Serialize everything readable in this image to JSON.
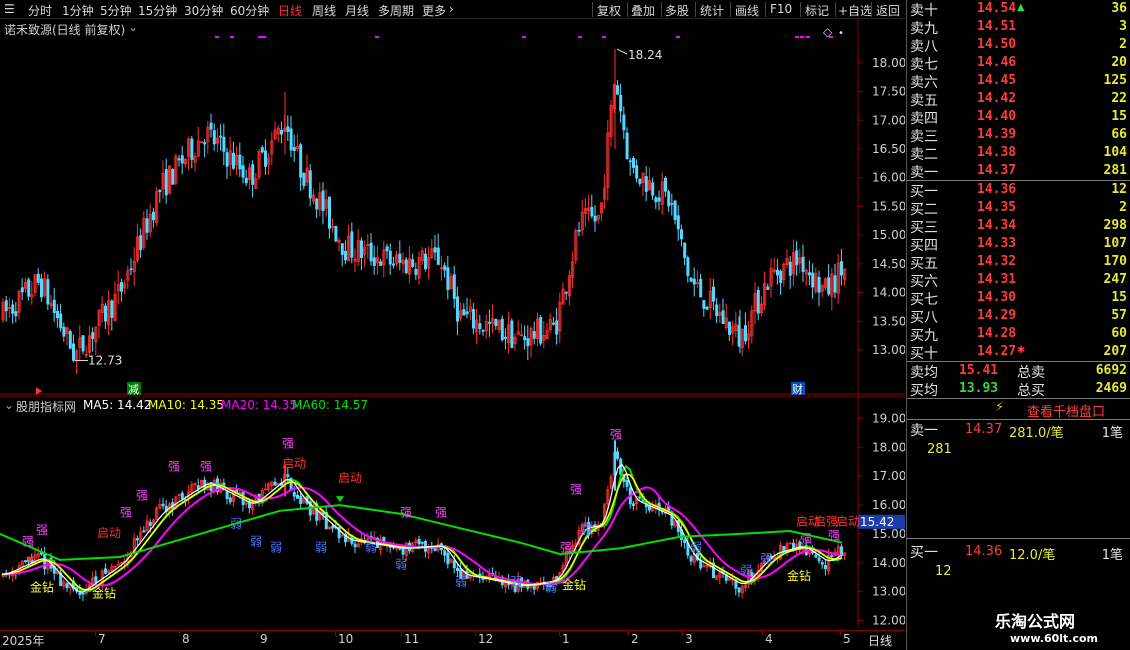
{
  "toolbar": {
    "periods": [
      "分时",
      "1分钟",
      "5分钟",
      "15分钟",
      "30分钟",
      "60分钟",
      "日线",
      "周线",
      "月线",
      "多周期",
      "更多"
    ],
    "active_period": "日线",
    "buttons": [
      "复权",
      "叠加",
      "多股",
      "统计",
      "画线",
      "F10",
      "标记",
      "+自选",
      "返回"
    ]
  },
  "main_chart": {
    "title": "诺禾致源(日线 前复权)",
    "high_label": "18.24",
    "low_label": "12.73",
    "marker_jian": "减",
    "marker_cai": "财",
    "y_ticks": [
      "18.00",
      "17.50",
      "17.00",
      "16.50",
      "16.00",
      "15.50",
      "15.00",
      "14.50",
      "14.00",
      "13.50",
      "13.00"
    ]
  },
  "indicator_chart": {
    "title": "股朋指标网",
    "ma5": "MA5: 14.42",
    "ma10": "MA10: 14.35",
    "ma20": "MA20: 14.35",
    "ma60": "MA60: 14.57",
    "current_price": "15.42",
    "y_ticks": [
      "19.00",
      "18.00",
      "17.00",
      "16.00",
      "15.00",
      "14.00",
      "13.00",
      "12.00"
    ],
    "labels": {
      "qiang": "强",
      "ruo": "弱",
      "qidong": "启动",
      "jinzuan": "金钻",
      "qiangruo": "启强"
    }
  },
  "bottom_axis": {
    "year_label": "2025年",
    "months": [
      "7",
      "8",
      "9",
      "10",
      "11",
      "12",
      "1",
      "2",
      "3",
      "4",
      "5"
    ],
    "period": "日线"
  },
  "orderbook": {
    "asks": [
      {
        "label": "卖十",
        "price": "14.54",
        "vol": "36",
        "tick": "up"
      },
      {
        "label": "卖九",
        "price": "14.51",
        "vol": "3"
      },
      {
        "label": "卖八",
        "price": "14.50",
        "vol": "2"
      },
      {
        "label": "卖七",
        "price": "14.46",
        "vol": "20"
      },
      {
        "label": "卖六",
        "price": "14.45",
        "vol": "125"
      },
      {
        "label": "卖五",
        "price": "14.42",
        "vol": "22"
      },
      {
        "label": "卖四",
        "price": "14.40",
        "vol": "15"
      },
      {
        "label": "卖三",
        "price": "14.39",
        "vol": "66"
      },
      {
        "label": "卖二",
        "price": "14.38",
        "vol": "104"
      },
      {
        "label": "卖一",
        "price": "14.37",
        "vol": "281"
      }
    ],
    "bids": [
      {
        "label": "买一",
        "price": "14.36",
        "vol": "12"
      },
      {
        "label": "买二",
        "price": "14.35",
        "vol": "2"
      },
      {
        "label": "买三",
        "price": "14.34",
        "vol": "298"
      },
      {
        "label": "买四",
        "price": "14.33",
        "vol": "107"
      },
      {
        "label": "买五",
        "price": "14.32",
        "vol": "170"
      },
      {
        "label": "买六",
        "price": "14.31",
        "vol": "247"
      },
      {
        "label": "买七",
        "price": "14.30",
        "vol": "15"
      },
      {
        "label": "买八",
        "price": "14.29",
        "vol": "57"
      },
      {
        "label": "买九",
        "price": "14.28",
        "vol": "60"
      },
      {
        "label": "买十",
        "price": "14.27",
        "vol": "207",
        "tick": "star"
      }
    ],
    "sell_avg_label": "卖均",
    "sell_avg": "15.41",
    "sell_total_label": "总卖",
    "sell_total": "6692",
    "buy_avg_label": "买均",
    "buy_avg": "13.93",
    "buy_total_label": "总买",
    "buy_total": "2469",
    "thousand_btn": "查看千档盘口",
    "ask1_label": "卖一",
    "ask1_price": "14.37",
    "ask1_vol": "281.0/笔",
    "ask1_count": "1笔",
    "ask1_detail": "281",
    "bid1_label": "买一",
    "bid1_price": "14.36",
    "bid1_vol": "12.0/笔",
    "bid1_count": "1笔",
    "bid1_detail": "12"
  },
  "watermark": {
    "name": "乐淘公式网",
    "url": "www.60lt.com"
  },
  "colors": {
    "up": "#ff3030",
    "down": "#54d8ff",
    "ma5": "#ffffff",
    "ma10": "#ffff00",
    "ma20": "#ff00ff",
    "ma60": "#00e000"
  }
}
